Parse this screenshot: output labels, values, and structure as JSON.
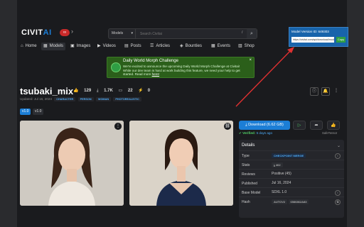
{
  "logo": {
    "text_a": "CIVIT",
    "text_b": "AI",
    "badge": "∞"
  },
  "search": {
    "category": "Models",
    "placeholder": "Search Civitai",
    "shortcut": "/"
  },
  "nav": [
    {
      "icon": "home-icon",
      "glyph": "⌂",
      "label": "Home"
    },
    {
      "icon": "models-icon",
      "glyph": "▦",
      "label": "Models"
    },
    {
      "icon": "images-icon",
      "glyph": "▣",
      "label": "Images"
    },
    {
      "icon": "videos-icon",
      "glyph": "▶",
      "label": "Videos"
    },
    {
      "icon": "posts-icon",
      "glyph": "▤",
      "label": "Posts"
    },
    {
      "icon": "articles-icon",
      "glyph": "☰",
      "label": "Articles"
    },
    {
      "icon": "bounties-icon",
      "glyph": "◈",
      "label": "Bounties"
    },
    {
      "icon": "events-icon",
      "glyph": "▦",
      "label": "Events"
    },
    {
      "icon": "shop-icon",
      "glyph": "▥",
      "label": "Shop"
    }
  ],
  "banner": {
    "title": "Daily World Morph Challenge",
    "desc": "We're excited to announce the upcoming Daily World Morph Challenge at Civitai! While our dev team is hard at work building this feature, we need your help to get started. Read more",
    "link": "here!",
    "close": "×"
  },
  "model": {
    "name": "tsubaki_mix",
    "likes": "129",
    "downloads": "1.7K",
    "comments": "22",
    "buzz": "0",
    "updated": "Updated: Jul 16, 2024",
    "tags": [
      "CHARACTER",
      "PERSON",
      "WOMAN",
      "PHOTOREALISTIC"
    ],
    "versions": [
      "v1.0",
      "v1.0"
    ]
  },
  "actions": {
    "download": "Download (6.62 GB)",
    "verified": "Verified:",
    "verified_when": "5 days ago",
    "safetensor": "SafeTensor"
  },
  "details": {
    "header": "Details",
    "rows": [
      {
        "k": "Type",
        "v": "CHECKPOINT MERGE"
      },
      {
        "k": "Stats",
        "v": "462"
      },
      {
        "k": "Reviews",
        "v": "Positive (45)"
      },
      {
        "k": "Published",
        "v": "Jul 16, 2024"
      },
      {
        "k": "Base Model",
        "v": "SDXL 1.0"
      },
      {
        "k": "Hash",
        "v": "AUTOV2",
        "v2": "6586862A83"
      }
    ]
  },
  "popup": {
    "label": "Model Version ID: 649303",
    "url": "https://civitai.com/api/download/models/649303",
    "copy": "Copy"
  },
  "colors": {
    "accent": "#1c7ed6",
    "banner": "#2b5f1a",
    "arrow": "#e03131"
  }
}
